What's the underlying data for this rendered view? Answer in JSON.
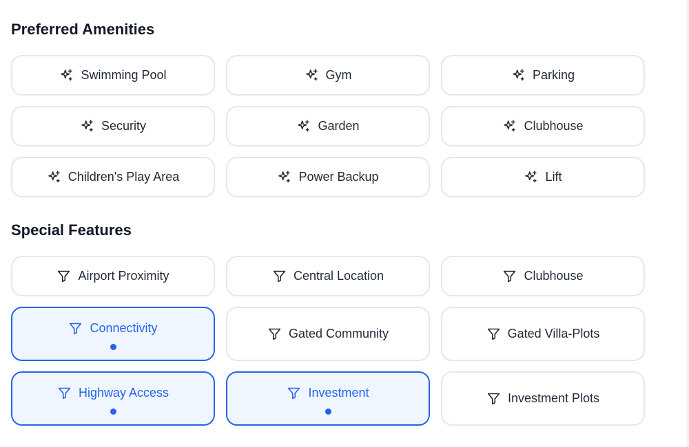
{
  "amenities": {
    "title": "Preferred Amenities",
    "icon": "sparkles-icon",
    "items": [
      {
        "label": "Swimming Pool"
      },
      {
        "label": "Gym"
      },
      {
        "label": "Parking"
      },
      {
        "label": "Security"
      },
      {
        "label": "Garden"
      },
      {
        "label": "Clubhouse"
      },
      {
        "label": "Children's Play Area"
      },
      {
        "label": "Power Backup"
      },
      {
        "label": "Lift"
      }
    ]
  },
  "features": {
    "title": "Special Features",
    "icon": "filter-icon",
    "items": [
      {
        "label": "Airport Proximity",
        "selected": false
      },
      {
        "label": "Central Location",
        "selected": false
      },
      {
        "label": "Clubhouse",
        "selected": false
      },
      {
        "label": "Connectivity",
        "selected": true
      },
      {
        "label": "Gated Community",
        "selected": false
      },
      {
        "label": "Gated Villa-Plots",
        "selected": false
      },
      {
        "label": "Highway Access",
        "selected": true
      },
      {
        "label": "Investment",
        "selected": true
      },
      {
        "label": "Investment Plots",
        "selected": false
      }
    ]
  },
  "colors": {
    "accent": "#2563eb",
    "selected_bg": "#eff6ff",
    "border": "#e5e7eb"
  }
}
